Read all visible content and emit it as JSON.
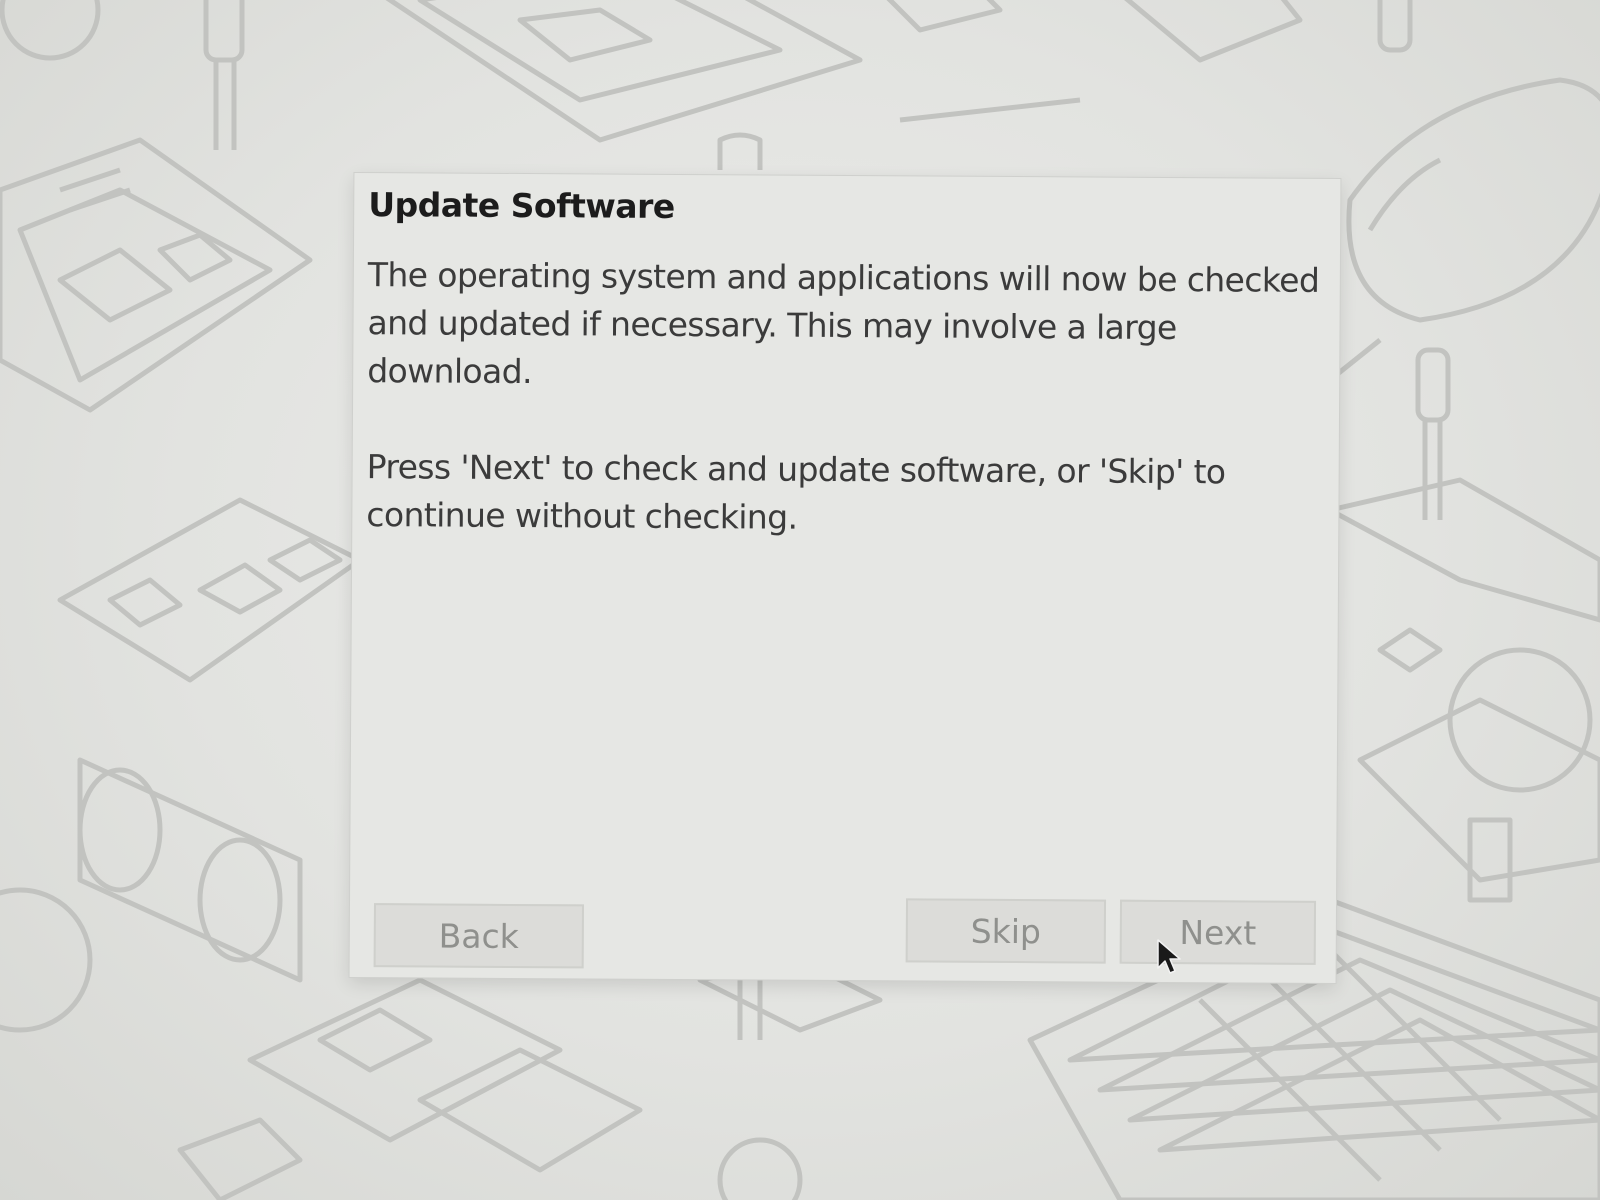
{
  "dialog": {
    "title": "Update Software",
    "paragraph1": "The operating system and applications will now be checked and updated if necessary. This may involve a large download.",
    "paragraph2": "Press 'Next' to check and update software, or 'Skip' to continue without checking.",
    "buttons": {
      "back": "Back",
      "skip": "Skip",
      "next": "Next"
    }
  },
  "cursor_icon": "arrow-pointer-icon",
  "colors": {
    "dialog_background": "#e6e7e4",
    "wallpaper_line": "#c2c3c0",
    "title_text": "#1c1c1c",
    "body_text": "#3b3b3b",
    "button_text": "#8f908d"
  }
}
